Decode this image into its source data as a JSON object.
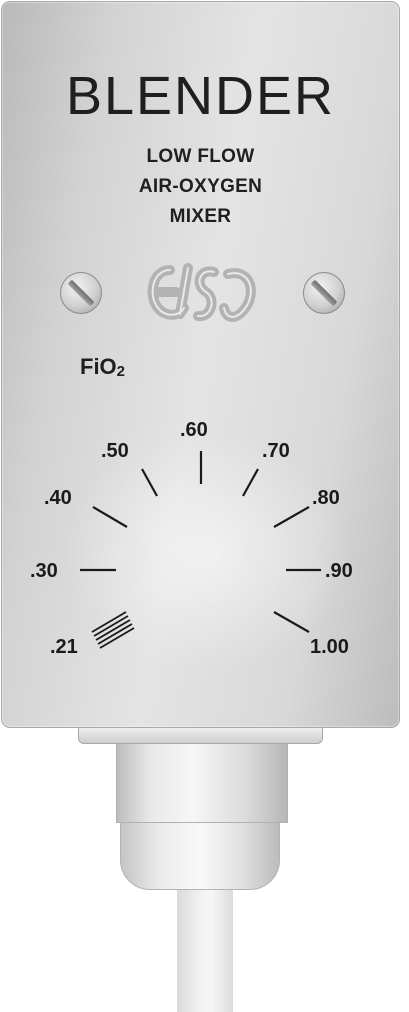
{
  "device": {
    "brand": "BLENDER",
    "subtitle_lines": [
      "LOW FLOW",
      "AIR-OXYGEN",
      "MIXER"
    ],
    "logo_icon": "elso-logo-icon",
    "dial_label": "FiO",
    "dial_label_subscript": "2",
    "scale": {
      "min": ".21",
      "labels": [
        ".30",
        ".40",
        ".50",
        ".60",
        ".70",
        ".80",
        ".90",
        "1.00"
      ]
    },
    "colors": {
      "panel": "#d9d9d9",
      "text": "#1f1f1f",
      "screw": "#c8c8c8"
    }
  }
}
